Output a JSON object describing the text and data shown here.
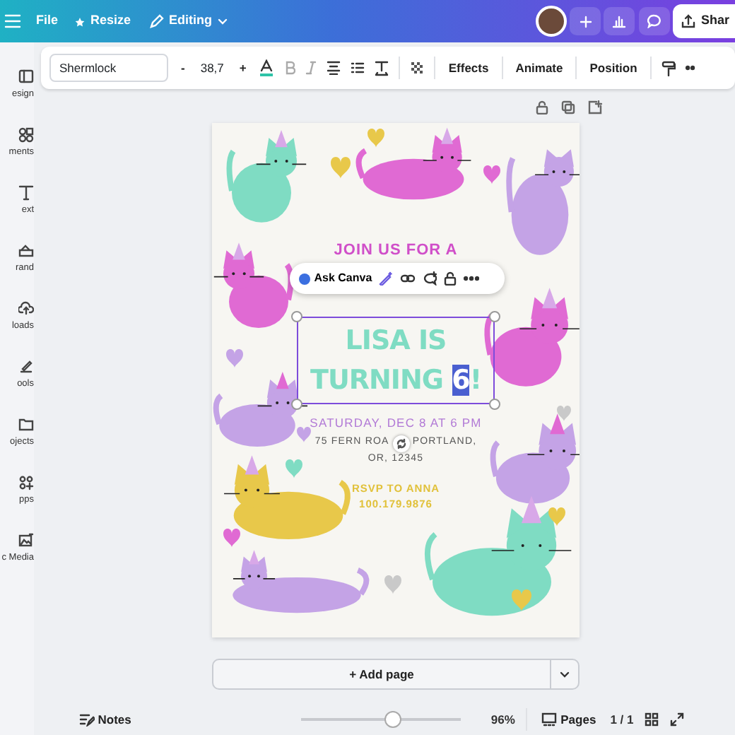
{
  "top_bar": {
    "menu": [
      {
        "kind": "file",
        "label": "File"
      },
      {
        "kind": "resize",
        "label": "Resize"
      },
      {
        "kind": "editing",
        "label": "Editing"
      }
    ],
    "share": "Shar"
  },
  "toolbar": {
    "font": "Shermlock",
    "minus": "-",
    "size": "38,7",
    "plus": "+",
    "buttons": [
      "Effects",
      "Animate",
      "Position"
    ]
  },
  "sidebar": {
    "items": [
      {
        "kind": "design",
        "label": "esign"
      },
      {
        "kind": "elements",
        "label": "ments"
      },
      {
        "kind": "text",
        "label": "ext"
      },
      {
        "kind": "brand",
        "label": "rand"
      },
      {
        "kind": "uploads",
        "label": "loads"
      },
      {
        "kind": "tools",
        "label": "ools"
      },
      {
        "kind": "projects",
        "label": "ojects"
      },
      {
        "kind": "apps",
        "label": "pps"
      },
      {
        "kind": "media",
        "label": "c Media"
      }
    ]
  },
  "design": {
    "intro": "JOIN US FOR A",
    "title_line_1": "LISA IS",
    "title_line_2": "TURNING",
    "title_selected": "6",
    "title_end": "!",
    "date": "SATURDAY, DEC 8 AT 6 PM",
    "address_start": "75 FERN ROA",
    "address_end": "PORTLAND,",
    "address_line_2": "OR, 12345",
    "rsvp": "RSVP TO ANNA",
    "phone": "100.179.9876"
  },
  "ask_canva": {
    "label": "Ask Canva"
  },
  "add_page": {
    "label": "+ Add page"
  },
  "bottom_bar": {
    "notes": "Notes",
    "zoom": {
      "level": 0.58
    },
    "zoom_reading": "96%",
    "pages": "Pages",
    "page_count": "1 / 1"
  }
}
